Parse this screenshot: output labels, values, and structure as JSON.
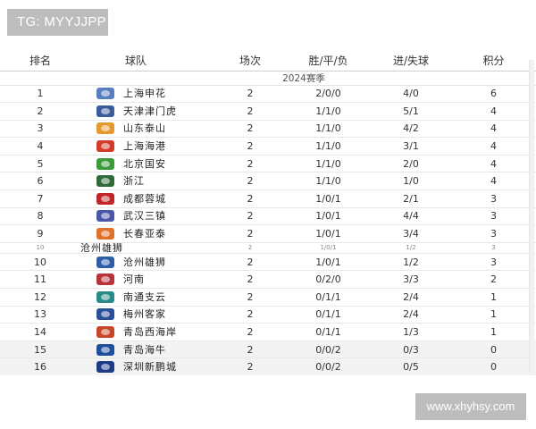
{
  "watermark_top": "TG: MYYJJPP",
  "watermark_bottom": "www.xhyhsy.com",
  "table": {
    "headers": {
      "rank": "排名",
      "team": "球队",
      "played": "场次",
      "wdl": "胜/平/负",
      "gfga": "进/失球",
      "points": "积分"
    },
    "season_label": "2024赛季",
    "rows": [
      {
        "rank": "1",
        "team": "上海申花",
        "played": "2",
        "wdl": "2/0/0",
        "gfga": "4/0",
        "points": "6",
        "logo_color": "#5a7fc0"
      },
      {
        "rank": "2",
        "team": "天津津门虎",
        "played": "2",
        "wdl": "1/1/0",
        "gfga": "5/1",
        "points": "4",
        "logo_color": "#3a5c9a"
      },
      {
        "rank": "3",
        "team": "山东泰山",
        "played": "2",
        "wdl": "1/1/0",
        "gfga": "4/2",
        "points": "4",
        "logo_color": "#e49a2e"
      },
      {
        "rank": "4",
        "team": "上海海港",
        "played": "2",
        "wdl": "1/1/0",
        "gfga": "3/1",
        "points": "4",
        "logo_color": "#d23a2a"
      },
      {
        "rank": "5",
        "team": "北京国安",
        "played": "2",
        "wdl": "1/1/0",
        "gfga": "2/0",
        "points": "4",
        "logo_color": "#3c9a3a"
      },
      {
        "rank": "6",
        "team": "浙江",
        "played": "2",
        "wdl": "1/1/0",
        "gfga": "1/0",
        "points": "4",
        "logo_color": "#2f6b3a"
      },
      {
        "rank": "7",
        "team": "成都蓉城",
        "played": "2",
        "wdl": "1/0/1",
        "gfga": "2/1",
        "points": "3",
        "logo_color": "#c0262a"
      },
      {
        "rank": "8",
        "team": "武汉三镇",
        "played": "2",
        "wdl": "1/0/1",
        "gfga": "4/4",
        "points": "3",
        "logo_color": "#4a57a8"
      },
      {
        "rank": "9",
        "team": "长春亚泰",
        "played": "2",
        "wdl": "1/0/1",
        "gfga": "3/4",
        "points": "3",
        "logo_color": "#e0702a"
      },
      {
        "rank": "10",
        "team": "沧州雄狮",
        "played": "2",
        "wdl": "1/0/1",
        "gfga": "1/2",
        "points": "3",
        "logo_color": "#2e5ea8"
      },
      {
        "rank": "11",
        "team": "河南",
        "played": "2",
        "wdl": "0/2/0",
        "gfga": "3/3",
        "points": "2",
        "logo_color": "#b8343a"
      },
      {
        "rank": "12",
        "team": "南通支云",
        "played": "2",
        "wdl": "0/1/1",
        "gfga": "2/4",
        "points": "1",
        "logo_color": "#2a8a8a"
      },
      {
        "rank": "13",
        "team": "梅州客家",
        "played": "2",
        "wdl": "0/1/1",
        "gfga": "2/4",
        "points": "1",
        "logo_color": "#2a4f9a"
      },
      {
        "rank": "14",
        "team": "青岛西海岸",
        "played": "2",
        "wdl": "0/1/1",
        "gfga": "1/3",
        "points": "1",
        "logo_color": "#c8462a"
      },
      {
        "rank": "15",
        "team": "青岛海牛",
        "played": "2",
        "wdl": "0/0/2",
        "gfga": "0/3",
        "points": "0",
        "logo_color": "#1f4f9a"
      },
      {
        "rank": "16",
        "team": "深圳新鹏城",
        "played": "2",
        "wdl": "0/0/2",
        "gfga": "0/5",
        "points": "0",
        "logo_color": "#1e3c88"
      }
    ]
  }
}
